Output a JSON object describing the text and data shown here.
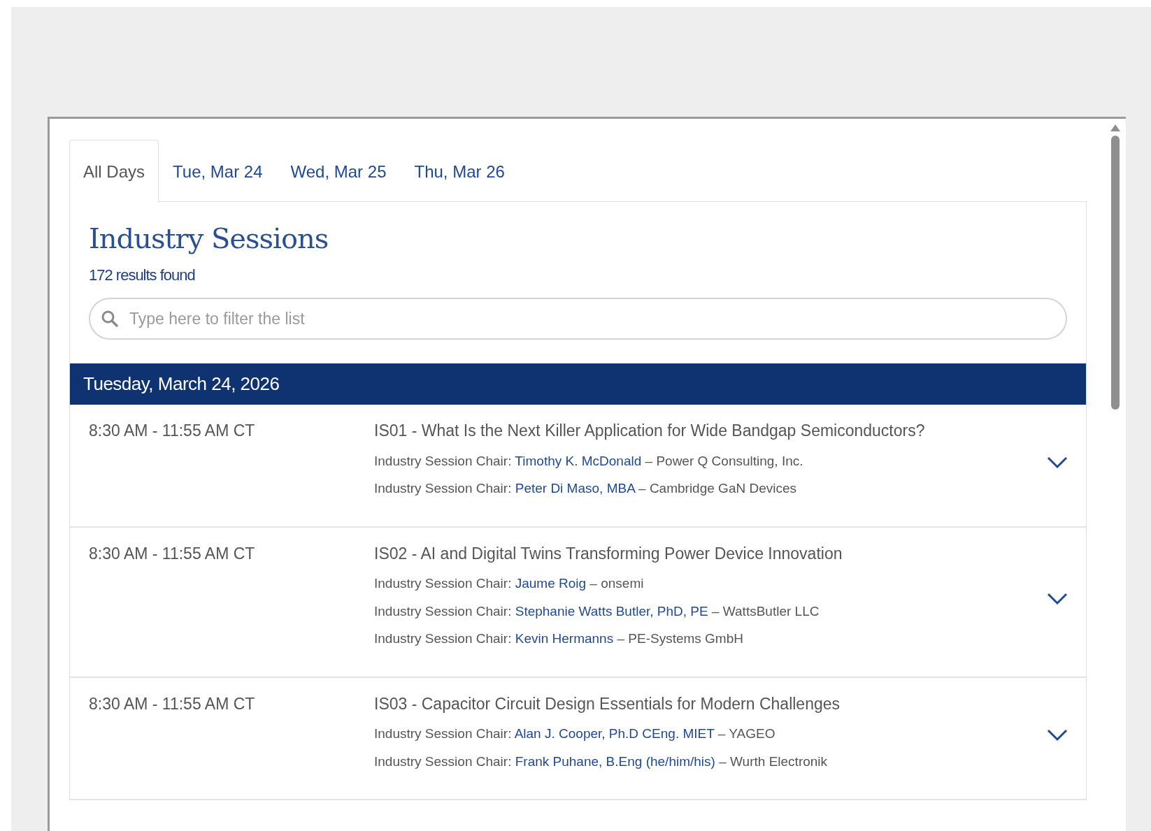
{
  "tabs": [
    {
      "label": "All Days",
      "selected": true
    },
    {
      "label": "Tue, Mar 24",
      "selected": false
    },
    {
      "label": "Wed, Mar 25",
      "selected": false
    },
    {
      "label": "Thu, Mar 26",
      "selected": false
    }
  ],
  "heading": "Industry Sessions",
  "results_count": "172 results found",
  "search": {
    "placeholder": "Type here to filter the list"
  },
  "day_header": "Tuesday, March 24, 2026",
  "sessions": [
    {
      "time": "8:30 AM - 11:55 AM CT",
      "title": "IS01 - What Is the Next Killer Application for Wide Bandgap Semiconductors?",
      "expanded": false,
      "chairs": [
        {
          "label": "Industry Session Chair:",
          "name": "Timothy K. McDonald",
          "affiliation": "– Power Q Consulting, Inc."
        },
        {
          "label": "Industry Session Chair:",
          "name": "Peter Di Maso, MBA",
          "affiliation": "– Cambridge GaN Devices"
        }
      ]
    },
    {
      "time": "8:30 AM - 11:55 AM CT",
      "title": "IS02 - AI and Digital Twins Transforming Power Device Innovation",
      "expanded": false,
      "chairs": [
        {
          "label": "Industry Session Chair:",
          "name": "Jaume Roig",
          "affiliation": "– onsemi"
        },
        {
          "label": "Industry Session Chair:",
          "name": "Stephanie Watts Butler, PhD, PE",
          "affiliation": "– WattsButler LLC"
        },
        {
          "label": "Industry Session Chair:",
          "name": "Kevin Hermanns",
          "affiliation": "– PE-Systems GmbH"
        }
      ]
    },
    {
      "time": "8:30 AM - 11:55 AM CT",
      "title": "IS03 - Capacitor Circuit Design Essentials for Modern Challenges",
      "expanded": false,
      "chairs": [
        {
          "label": "Industry Session Chair:",
          "name": "Alan J. Cooper, Ph.D CEng. MIET",
          "affiliation": "– YAGEO"
        },
        {
          "label": "Industry Session Chair:",
          "name": "Frank Puhane, B.Eng (he/him/his)",
          "affiliation": "– Wurth Electronik"
        }
      ]
    }
  ]
}
